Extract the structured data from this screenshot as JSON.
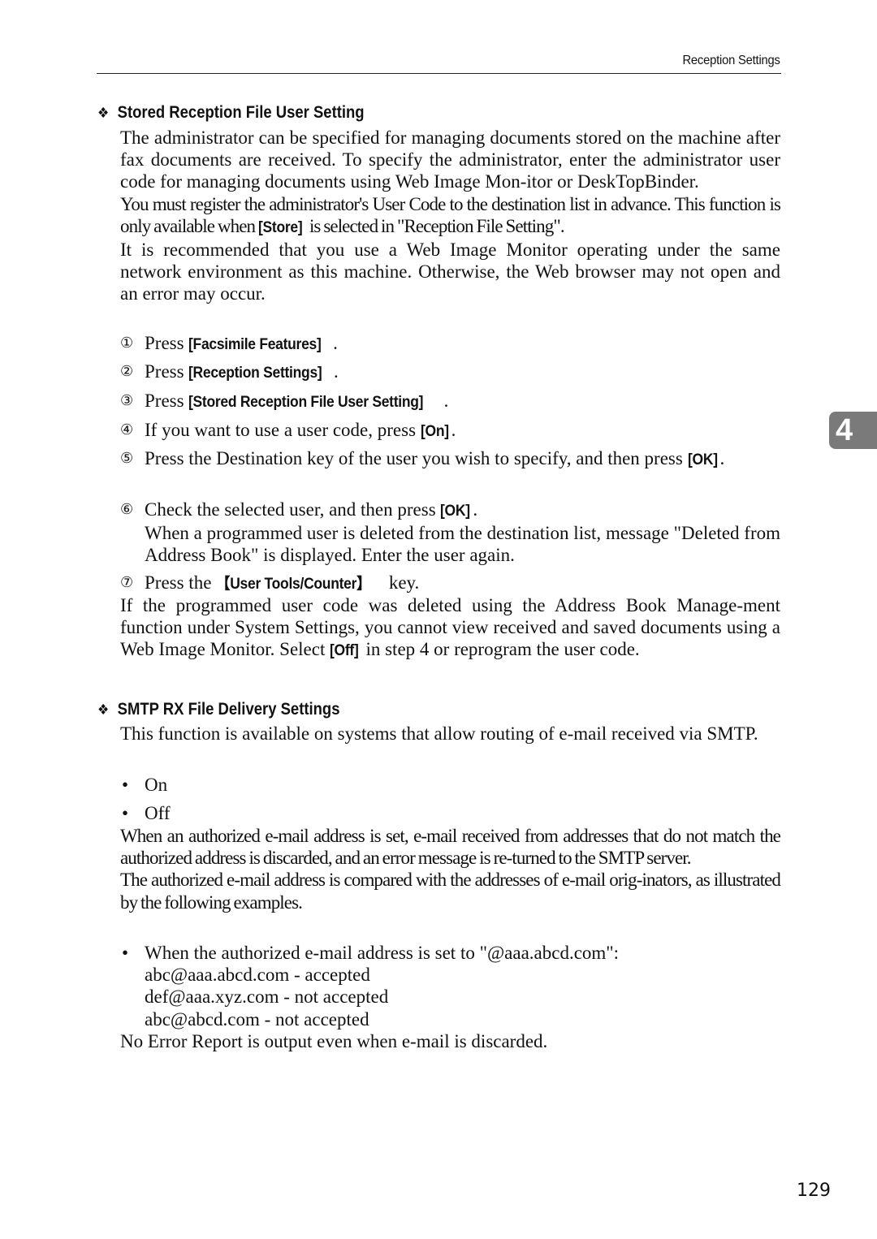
{
  "header": {
    "running_title": "Reception Settings"
  },
  "chapter_tab": "4",
  "page_number": "129",
  "section1": {
    "heading": "Stored Reception File User Setting",
    "para1": "The administrator can be specified for managing documents stored on the machine after fax documents are received. To specify the administrator, enter the administrator user code for managing documents using Web Image Mon-itor or DeskTopBinder.",
    "para2_pre": "You must register the administrator's User Code to the destination list in advance. This function is only available when ",
    "para2_key": "[Store]",
    "para2_post": " is selected in \"Reception File Setting\".",
    "para3": "It is recommended that you use a Web Image Monitor operating under the same network environment as this machine. Otherwise, the Web browser may not open and an error may occur.",
    "steps": [
      {
        "num": "①",
        "pre": "Press ",
        "key": "[Facsimile Features]",
        "post": "."
      },
      {
        "num": "②",
        "pre": "Press ",
        "key": "[Reception Settings]",
        "post": "."
      },
      {
        "num": "③",
        "pre": "Press ",
        "key": "[Stored Reception File User Setting]",
        "post": "."
      },
      {
        "num": "④",
        "pre": "If you want to use a user code, press ",
        "key": "[On]",
        "post": "."
      },
      {
        "num": "⑤",
        "pre": "Press the Destination key of the user you wish to specify, and then press ",
        "key": "[OK]",
        "post": "."
      },
      {
        "num": "⑥",
        "pre": "Check the selected user, and then press ",
        "key": "[OK]",
        "post": ".",
        "note": "When a programmed user is deleted from the destination list, message \"Deleted from Address Book\" is displayed. Enter the user again."
      },
      {
        "num": "⑦",
        "pre": "Press the ",
        "key": "【User Tools/Counter】",
        "post": " key."
      }
    ],
    "para4_pre": "If the programmed user code was deleted using the Address Book Manage-ment function under System Settings, you cannot view received and saved documents using a Web Image Monitor. Select ",
    "para4_key": "[Off]",
    "para4_post": " in step 4 or reprogram the user code."
  },
  "section2": {
    "heading": "SMTP RX File Delivery Settings",
    "para1": "This function is available on systems that allow routing of e-mail received via SMTP.",
    "options": [
      "On",
      "Off"
    ],
    "para2": "When an authorized e-mail address is set, e-mail received from addresses that do not match the authorized address is discarded, and an error message is re-turned to the SMTP server.",
    "para3": "The authorized e-mail address is compared with the addresses of e-mail orig-inators, as illustrated by the following examples.",
    "example_intro": "When the authorized e-mail address is set to \"@aaa.abcd.com\":",
    "examples": [
      "abc@aaa.abcd.com - accepted",
      "def@aaa.xyz.com - not accepted",
      "abc@abcd.com - not accepted"
    ],
    "para4": "No Error Report is output even when e-mail is discarded."
  }
}
